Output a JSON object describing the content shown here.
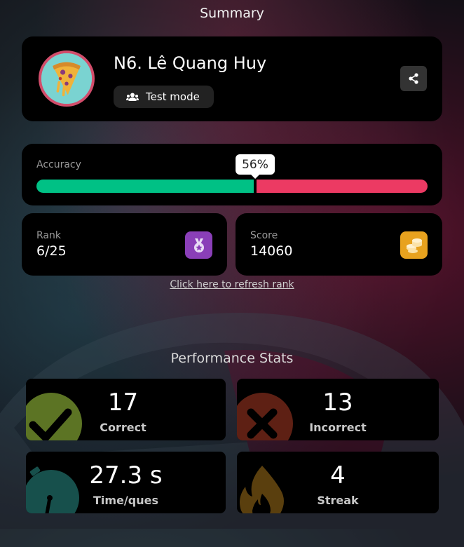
{
  "header": {
    "title": "Summary"
  },
  "player": {
    "name": "N6. Lê Quang Huy",
    "mode": "Test mode",
    "avatar_icon": "pizza-slice-avatar"
  },
  "actions": {
    "share_icon": "share-icon"
  },
  "accuracy": {
    "label": "Accuracy",
    "percent_text": "56%",
    "percent": 56,
    "correct_color": "#00c185",
    "incorrect_color": "#ec3a63"
  },
  "rank": {
    "label": "Rank",
    "value": "6/25",
    "icon": "medal-icon",
    "icon_color": "#8a3fb8"
  },
  "score": {
    "label": "Score",
    "value": "14060",
    "icon": "coins-icon",
    "icon_color": "#e8a21e"
  },
  "refresh": {
    "label": "Click here to refresh rank"
  },
  "performance": {
    "title": "Performance Stats",
    "stats": [
      {
        "value": "17",
        "label": "Correct",
        "icon": "check-icon",
        "color": "#6b8a2a"
      },
      {
        "value": "13",
        "label": "Incorrect",
        "icon": "cross-icon",
        "color": "#7a2a1a"
      },
      {
        "value": "27.3 s",
        "label": "Time/ques",
        "icon": "stopwatch-icon",
        "color": "#1f5a55"
      },
      {
        "value": "4",
        "label": "Streak",
        "icon": "fire-icon",
        "color": "#6a4a10"
      }
    ]
  }
}
